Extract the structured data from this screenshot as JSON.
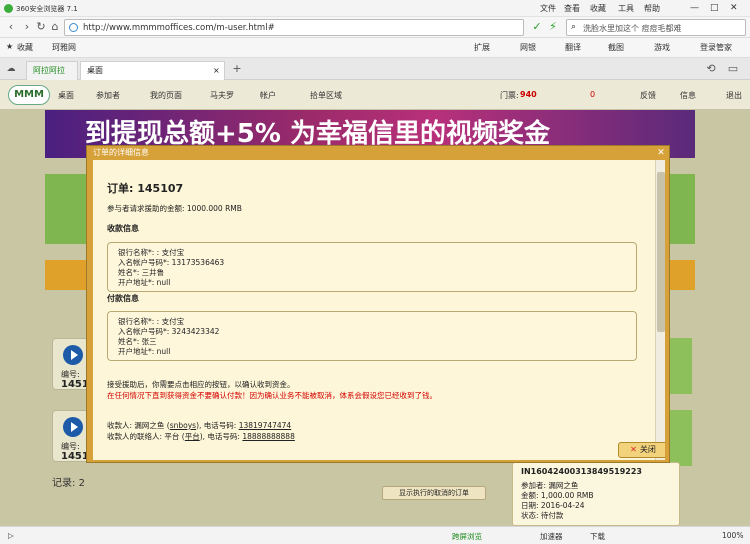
{
  "browser": {
    "title": "360安全浏览器 7.1",
    "menu": [
      "文件",
      "查看",
      "收藏",
      "工具",
      "帮助"
    ],
    "url": "http://www.mmmmoffices.com/m-user.html#",
    "search_placeholder": "洗脸水里加这个 痘痘毛都难",
    "favorites": [
      "收藏",
      "珂雅网"
    ],
    "right_tools": [
      "扩展",
      "网银",
      "翻译",
      "截图",
      "游戏",
      "登录管家"
    ],
    "tabs": [
      {
        "label": "阿拉阿拉",
        "active": false
      },
      {
        "label": "桌面",
        "active": true
      }
    ]
  },
  "site": {
    "menu": [
      "桌面",
      "参加者",
      "我的页面",
      "马夫罗",
      "帐户",
      "拾单区域"
    ],
    "currency_label": "门票:",
    "currency_value": "940",
    "right_menu": [
      "0",
      "反馈",
      "信息",
      "退出"
    ],
    "banner_text": "到提现总额+5%  为幸福信里的视频奖金",
    "records_label": "记录:",
    "records_value": "2",
    "show_button": "显示执行的取消的订单",
    "cards": [
      {
        "label": "编号:",
        "value": "1451"
      },
      {
        "label": "编号:",
        "value": "1451"
      }
    ],
    "order_card": {
      "id": "IN16042400313849519223",
      "participant_label": "参加者:",
      "participant": "漏网之鱼",
      "amount_label": "金额:",
      "amount": "1,000.00 RMB",
      "date_label": "日期:",
      "date": "2016-04-24",
      "status_label": "状态:",
      "status": "待付款"
    }
  },
  "dialog": {
    "header": "订单的详细信息",
    "title": "订单: 145107",
    "amount_text": "参与者请求援助的金额:  1000.000 RMB",
    "receiver_section": "收款信息",
    "receiver": {
      "bank": "银行名称*: : 支付宝",
      "account": "入名帐户号码*: 13173536463",
      "name": "姓名*: 三井鲁",
      "address": "开户地址*: null"
    },
    "payer_section": "付款信息",
    "payer": {
      "bank": "银行名称*: : 支付宝",
      "account": "入名帐户号码*: 3243423342",
      "name": "姓名*: 张三",
      "address": "开户地址*: null"
    },
    "note1": "接受援助后，你需要点击相应的按钮，以确认收到资金。",
    "note2": "在任何情况下直到获得资金不要确认付款！因为确认业务不能被取消，体系会假设您已经收到了钱。",
    "receiver_contact_prefix": "收款人: 漏网之鱼 (",
    "receiver_contact_user": "snboys",
    "receiver_contact_phone_label": "), 电话号码:",
    "receiver_contact_phone": "13819747474",
    "payer_contact_prefix": "收款人的联络人: 平台 (",
    "payer_contact_user": "平台",
    "payer_contact_phone_label": "), 电话号码:",
    "payer_contact_phone": "18888888888",
    "close_label": "关闭"
  },
  "statusbar": {
    "items": [
      "跨屏浏览",
      "加速器",
      "下载",
      "100%"
    ]
  }
}
